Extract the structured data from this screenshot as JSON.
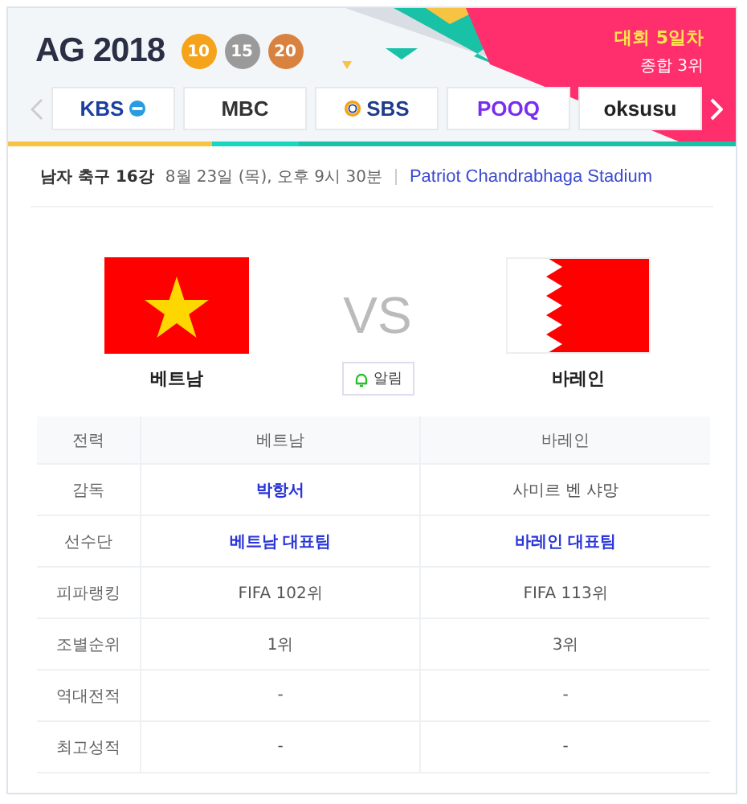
{
  "header": {
    "logo": "AG 2018",
    "medals": [
      {
        "kind": "gold",
        "count": "10"
      },
      {
        "kind": "silver",
        "count": "15"
      },
      {
        "kind": "bronze",
        "count": "20"
      }
    ],
    "day": "대회 5일차",
    "rank": "종합 3위"
  },
  "channels": [
    {
      "kind": "kbs",
      "label": "KBS"
    },
    {
      "kind": "mbc",
      "label": "MBC"
    },
    {
      "kind": "sbs",
      "label": "SBS"
    },
    {
      "kind": "pooq",
      "label": "POOQ"
    },
    {
      "kind": "oksusu",
      "label": "oksusu"
    }
  ],
  "match": {
    "event": "남자 축구 16강",
    "datetime": "8월 23일 (목), 오후 9시 30분",
    "stadium": "Patriot Chandrabhaga Stadium",
    "home": "베트남",
    "away": "바레인",
    "vs": "VS",
    "alarm": "알림"
  },
  "table": {
    "columns": [
      "전력",
      "베트남",
      "바레인"
    ],
    "rows": [
      {
        "cells": [
          {
            "text": "감독",
            "kind": "label"
          },
          {
            "text": "박항서",
            "kind": "link"
          },
          {
            "text": "사미르 벤 샤망",
            "kind": "plain"
          }
        ]
      },
      {
        "cells": [
          {
            "text": "선수단",
            "kind": "label"
          },
          {
            "text": "베트남 대표팀",
            "kind": "link"
          },
          {
            "text": "바레인 대표팀",
            "kind": "link"
          }
        ]
      },
      {
        "cells": [
          {
            "text": "피파랭킹",
            "kind": "label"
          },
          {
            "text": "FIFA 102위",
            "kind": "plain"
          },
          {
            "text": "FIFA 113위",
            "kind": "plain"
          }
        ]
      },
      {
        "cells": [
          {
            "text": "조별순위",
            "kind": "label"
          },
          {
            "text": "1위",
            "kind": "plain"
          },
          {
            "text": "3위",
            "kind": "plain"
          }
        ]
      },
      {
        "cells": [
          {
            "text": "역대전적",
            "kind": "label"
          },
          {
            "text": "-",
            "kind": "plain"
          },
          {
            "text": "-",
            "kind": "plain"
          }
        ]
      },
      {
        "cells": [
          {
            "text": "최고성적",
            "kind": "label"
          },
          {
            "text": "-",
            "kind": "plain"
          },
          {
            "text": "-",
            "kind": "plain"
          }
        ]
      }
    ]
  }
}
